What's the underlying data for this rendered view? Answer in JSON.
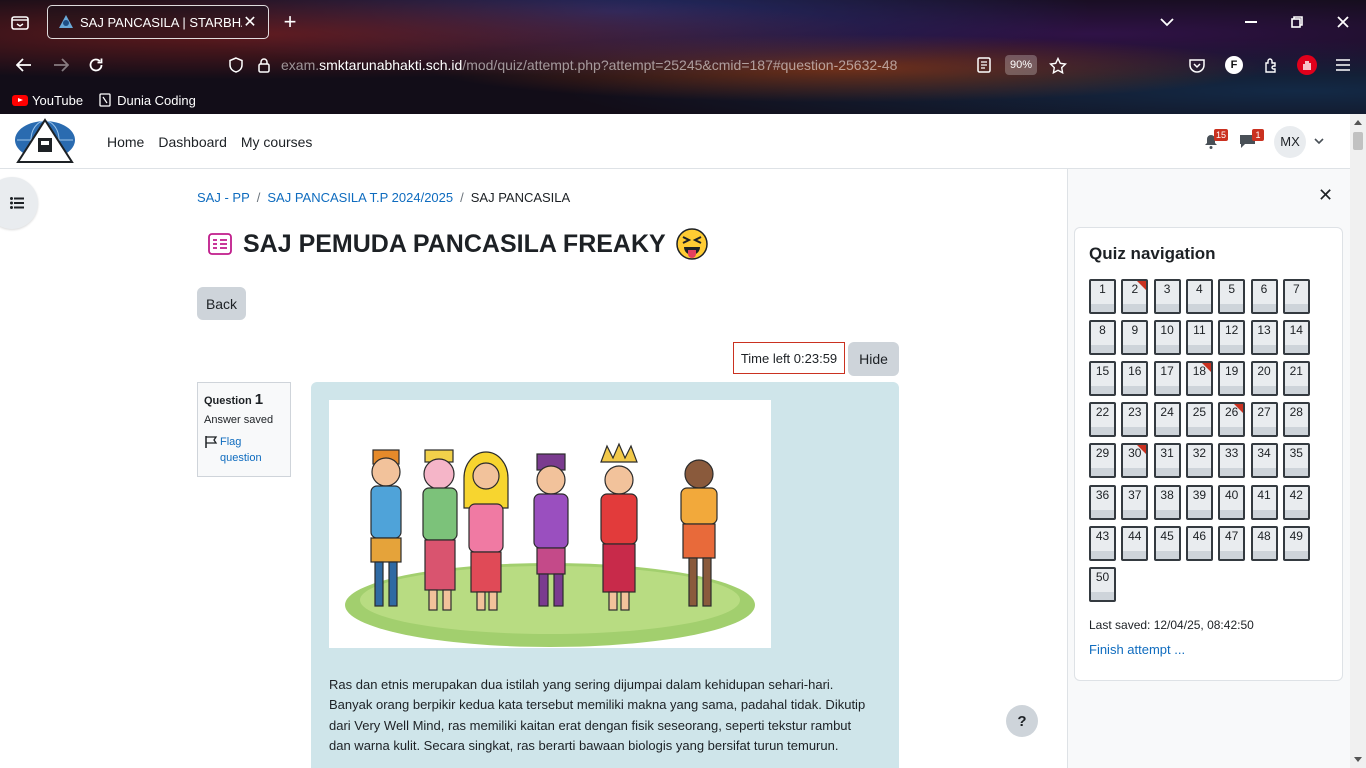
{
  "browser": {
    "tab_title": "SAJ PANCASILA | STARBHAK",
    "url_prefix": "exam.",
    "url_host": "smktarunabhakti.sch.id",
    "url_path": "/mod/quiz/attempt.php?attempt=25245&cmid=187#question-25632-48",
    "zoom": "90%",
    "bookmarks": [
      {
        "label": "YouTube",
        "icon": "youtube-icon"
      },
      {
        "label": "Dunia Coding",
        "icon": "folder-icon"
      }
    ]
  },
  "navbar": {
    "links": [
      "Home",
      "Dashboard",
      "My courses"
    ],
    "notifications_count": "15",
    "messages_count": "1",
    "user_initials": "MX"
  },
  "breadcrumb": {
    "items": [
      "SAJ - PP",
      "SAJ PANCASILA T.P 2024/2025",
      "SAJ PANCASILA"
    ],
    "separator": "/"
  },
  "page": {
    "title": "SAJ PEMUDA PANCASILA FREAKY",
    "title_emoji": "😝",
    "back_label": "Back",
    "timer_text": "Time left 0:23:59",
    "hide_label": "Hide",
    "help_label": "?"
  },
  "question": {
    "label": "Question",
    "number": "1",
    "state": "Answer saved",
    "flag_label": "Flag question",
    "text": "Ras dan etnis merupakan dua istilah yang sering dijumpai dalam kehidupan sehari-hari. Banyak orang berpikir kedua kata tersebut memiliki makna yang sama, padahal tidak. Dikutip dari Very Well Mind, ras memiliki kaitan erat dengan fisik seseorang, seperti tekstur rambut dan warna kulit. Secara singkat, ras berarti bawaan biologis yang bersifat turun temurun."
  },
  "quiz_nav": {
    "title": "Quiz navigation",
    "flagged": [
      2,
      18,
      26,
      30
    ],
    "last_saved": "Last saved: 12/04/25, 08:42:50",
    "finish_label": "Finish attempt ..."
  },
  "colors": {
    "link": "#0f6cbf",
    "flag": "#ca3120",
    "question_bg": "#cfe5ea",
    "button_bg": "#ced4da",
    "quiz_icon": "#c01c8b"
  }
}
